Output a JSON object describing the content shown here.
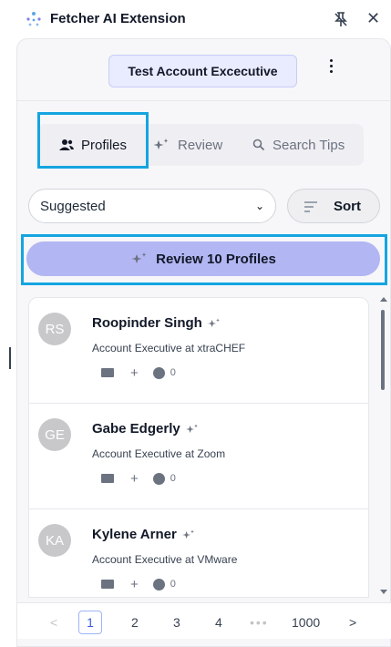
{
  "header": {
    "title": "Fetcher AI Extension"
  },
  "account": {
    "label": "Test Account Excecutive"
  },
  "tabs": [
    {
      "label": "Profiles",
      "icon": "people-icon"
    },
    {
      "label": "Review",
      "icon": "sparkle-icon"
    },
    {
      "label": "Search Tips",
      "icon": "search-icon"
    }
  ],
  "filter": {
    "selected": "Suggested",
    "sort_label": "Sort"
  },
  "review_button": {
    "label": "Review 10 Profiles"
  },
  "profiles": [
    {
      "initials": "RS",
      "name": "Roopinder Singh",
      "role": "Account Executive at xtraCHEF",
      "count": "0"
    },
    {
      "initials": "GE",
      "name": "Gabe Edgerly",
      "role": "Account Executive at Zoom",
      "count": "0"
    },
    {
      "initials": "KA",
      "name": "Kylene Arner",
      "role": "Account Executive at VMware",
      "count": "0"
    }
  ],
  "pagination": {
    "prev": "<",
    "pages": [
      "1",
      "2",
      "3",
      "4"
    ],
    "dots": "•••",
    "last": "1000",
    "next": ">",
    "current": "1"
  },
  "colors": {
    "accent": "#b2b6f3",
    "highlight": "#14a5e0",
    "account_bg": "#e9ebfe"
  }
}
